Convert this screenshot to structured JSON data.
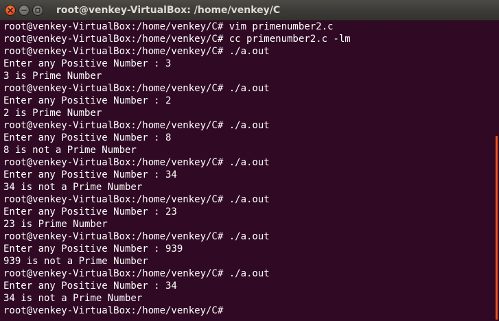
{
  "window": {
    "title": "root@venkey-VirtualBox: /home/venkey/C"
  },
  "terminal": {
    "lines": [
      "root@venkey-VirtualBox:/home/venkey/C# vim primenumber2.c",
      "root@venkey-VirtualBox:/home/venkey/C# cc primenumber2.c -lm",
      "root@venkey-VirtualBox:/home/venkey/C# ./a.out",
      "Enter any Positive Number : 3",
      "3 is Prime Number",
      "root@venkey-VirtualBox:/home/venkey/C# ./a.out",
      "Enter any Positive Number : 2",
      "2 is Prime Number",
      "root@venkey-VirtualBox:/home/venkey/C# ./a.out",
      "Enter any Positive Number : 8",
      "8 is not a Prime Number",
      "root@venkey-VirtualBox:/home/venkey/C# ./a.out",
      "Enter any Positive Number : 34",
      "34 is not a Prime Number",
      "root@venkey-VirtualBox:/home/venkey/C# ./a.out",
      "Enter any Positive Number : 23",
      "23 is Prime Number",
      "root@venkey-VirtualBox:/home/venkey/C# ./a.out",
      "Enter any Positive Number : 939",
      "939 is not a Prime Number",
      "root@venkey-VirtualBox:/home/venkey/C# ./a.out",
      "Enter any Positive Number : 34",
      "34 is not a Prime Number",
      "root@venkey-VirtualBox:/home/venkey/C# "
    ]
  },
  "icons": {
    "close": "close-icon",
    "minimize": "minimize-icon",
    "maximize": "maximize-icon"
  },
  "colors": {
    "terminal_background": "#300a24",
    "terminal_text": "#ffffff",
    "close_button": "#df4b16",
    "scrollbar_thumb": "#e9541f"
  }
}
